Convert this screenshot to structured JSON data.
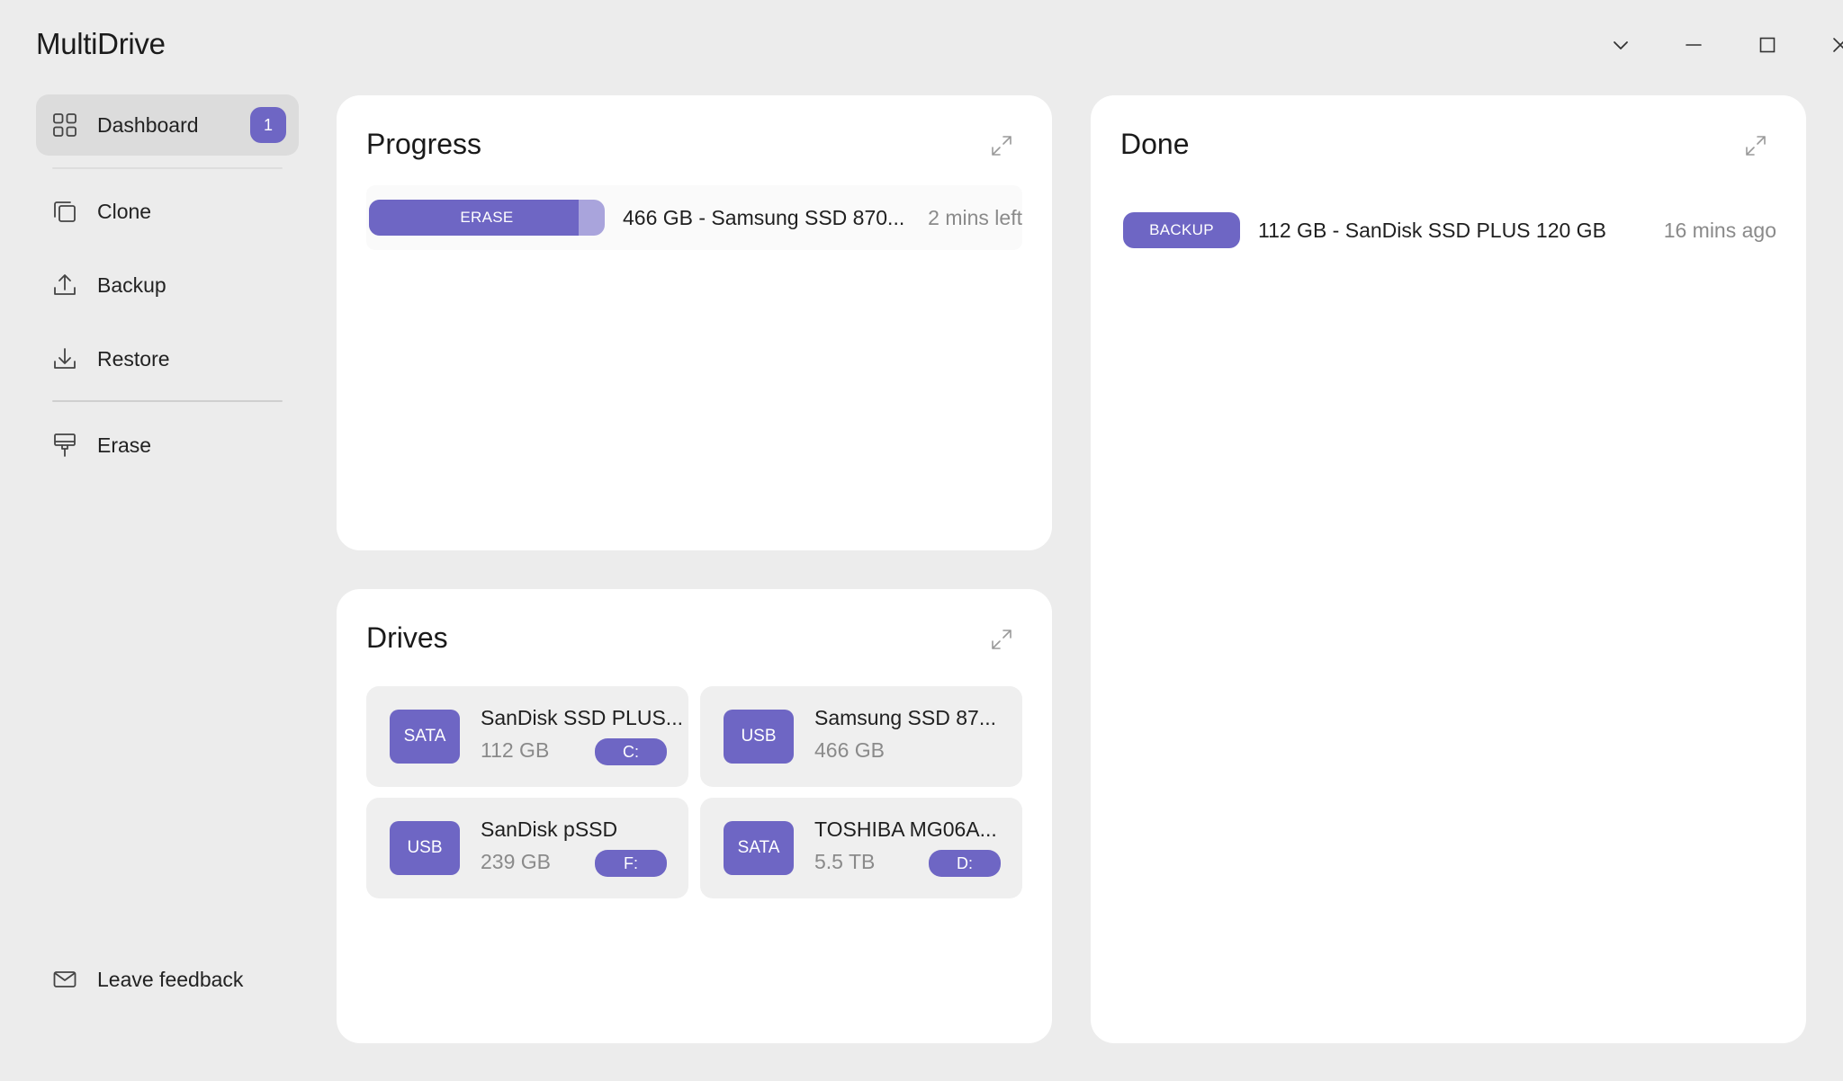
{
  "app": {
    "title": "MultiDrive"
  },
  "window_controls": {
    "dropdown_icon": "chevron-down-icon",
    "minimize_icon": "minimize-icon",
    "maximize_icon": "maximize-icon",
    "close_icon": "close-icon"
  },
  "sidebar": {
    "items": [
      {
        "label": "Dashboard",
        "icon": "dashboard-grid-icon",
        "badge": "1",
        "active": true
      },
      {
        "label": "Clone",
        "icon": "clone-icon"
      },
      {
        "label": "Backup",
        "icon": "upload-icon"
      },
      {
        "label": "Restore",
        "icon": "download-icon"
      },
      {
        "label": "Erase",
        "icon": "eraser-icon"
      }
    ],
    "feedback": {
      "label": "Leave feedback",
      "icon": "mail-icon"
    }
  },
  "progress_panel": {
    "title": "Progress",
    "jobs": [
      {
        "type": "ERASE",
        "progress": 0.89,
        "name": "466 GB - Samsung SSD 870...",
        "time": "2 mins left"
      }
    ]
  },
  "done_panel": {
    "title": "Done",
    "jobs": [
      {
        "type": "BACKUP",
        "name": "112 GB - SanDisk SSD PLUS 120 GB",
        "time": "16 mins ago"
      }
    ]
  },
  "drives_panel": {
    "title": "Drives",
    "drives": [
      {
        "type": "SATA",
        "name": "SanDisk SSD PLUS...",
        "size": "112 GB",
        "letter": "C:"
      },
      {
        "type": "USB",
        "name": "Samsung SSD 87...",
        "size": "466 GB",
        "letter": ""
      },
      {
        "type": "USB",
        "name": "SanDisk pSSD",
        "size": "239 GB",
        "letter": "F:"
      },
      {
        "type": "SATA",
        "name": "TOSHIBA MG06A...",
        "size": "5.5 TB",
        "letter": "D:"
      }
    ]
  },
  "colors": {
    "accent": "#6e66c4",
    "accent_light": "#a9a4dc",
    "background": "#ececec",
    "panel": "#ffffff"
  }
}
